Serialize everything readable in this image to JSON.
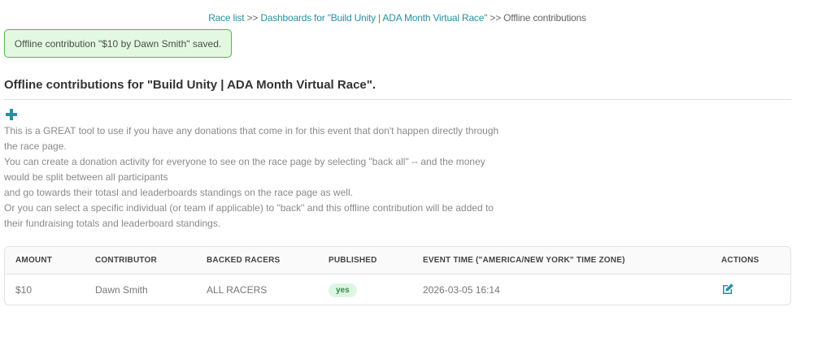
{
  "breadcrumb": {
    "link1": "Race list",
    "sep1": ">>",
    "link2": "Dashboards for \"Build Unity | ADA Month Virtual Race\"",
    "sep2": ">>",
    "current": "Offline contributions"
  },
  "alert": {
    "message": "Offline contribution \"$10 by Dawn Smith\" saved."
  },
  "page": {
    "title": "Offline contributions for \"Build Unity | ADA Month Virtual Race\"."
  },
  "add_icon": "plus-icon",
  "description": [
    "This is a GREAT tool to use if you have any donations that come in for this event that don't happen directly through the race page.",
    "You can create a donation activity for everyone to see on the race page by selecting \"back all\" -- and the money would be split between all participants",
    "and go towards their totasl and leaderboards standings on the race page as well.",
    "Or you can select a specific individual (or team if applicable) to \"back\" and this offline contribution will be added to their fundraising totals and leaderboard standings."
  ],
  "table": {
    "headers": [
      "AMOUNT",
      "CONTRIBUTOR",
      "BACKED RACERS",
      "PUBLISHED",
      "EVENT TIME (\"AMERICA/NEW YORK\" TIME ZONE)",
      "ACTIONS"
    ],
    "rows": [
      {
        "amount": "$10",
        "contributor": "Dawn Smith",
        "backed": "ALL RACERS",
        "published": "yes",
        "event_time": "2026-03-05 16:14",
        "action_icon": "edit-icon"
      }
    ]
  },
  "colors": {
    "accent": "#2a8fa3",
    "alert_bg": "#e3f8e1",
    "alert_border": "#5fae57",
    "badge_bg": "#dff5e3",
    "badge_text": "#2e8b47"
  }
}
